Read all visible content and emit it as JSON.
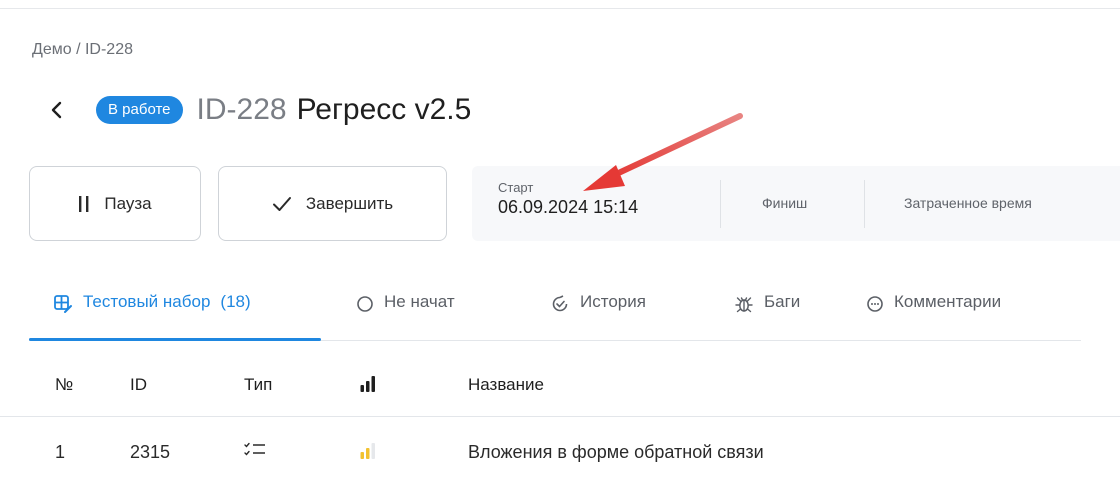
{
  "breadcrumb": "Демо / ID-228",
  "header": {
    "status": "В работе",
    "id": "ID-228",
    "name": "Регресс v2.5"
  },
  "actions": {
    "pause_label": "Пауза",
    "finish_label": "Завершить"
  },
  "timing": {
    "start_label": "Старт",
    "start_value": "06.09.2024 15:14",
    "finish_label": "Финиш",
    "spent_label": "Затраченное время"
  },
  "tabs": [
    {
      "label": "Тестовый набор",
      "count": "(18)",
      "icon": "test-suite-icon",
      "active": true
    },
    {
      "label": "Не начат",
      "icon": "circle-icon"
    },
    {
      "label": "История",
      "icon": "history-icon"
    },
    {
      "label": "Баги",
      "icon": "bug-icon"
    },
    {
      "label": "Комментарии",
      "icon": "comment-icon"
    }
  ],
  "table": {
    "columns": [
      "№",
      "ID",
      "Тип",
      "",
      "Название"
    ],
    "rows": [
      {
        "num": "1",
        "id": "2315",
        "type_icon": "checklist-icon",
        "priority": "medium",
        "name": "Вложения в форме обратной связи"
      }
    ]
  },
  "colors": {
    "accent": "#1f87e0",
    "priority_medium": "#f2c230"
  }
}
